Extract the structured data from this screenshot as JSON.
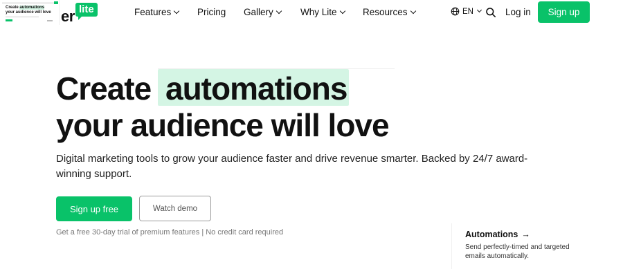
{
  "logo": {
    "text": "er",
    "badge": "lite"
  },
  "nav": {
    "items": [
      {
        "label": "Features",
        "has_dropdown": true
      },
      {
        "label": "Pricing",
        "has_dropdown": false
      },
      {
        "label": "Gallery",
        "has_dropdown": true
      },
      {
        "label": "Why Lite",
        "has_dropdown": true
      },
      {
        "label": "Resources",
        "has_dropdown": true
      }
    ],
    "language": "EN",
    "login": "Log in",
    "signup": "Sign up"
  },
  "hero": {
    "title_prefix": "Create",
    "title_highlight": "automations",
    "title_line2": "your audience will love",
    "subtitle": "Digital marketing tools to grow your audience faster and drive revenue smarter. Backed by 24/7 award-winning support.",
    "primary_cta": "Sign up free",
    "secondary_cta": "Watch demo",
    "note": "Get a free 30-day trial of premium features | No credit card required"
  },
  "thumbnail": {
    "title_prefix": "Create",
    "title_highlight": "automations",
    "title_line2": "your audience will love"
  },
  "feature_card": {
    "title": "Automations",
    "arrow": "→",
    "description": "Send perfectly-timed and targeted emails automatically."
  },
  "colors": {
    "brand_green": "#09c269",
    "highlight_bg": "#d4f5e4"
  },
  "icons": [
    "globe-icon",
    "search-icon",
    "chevron-down-icon",
    "arrow-right-icon"
  ]
}
